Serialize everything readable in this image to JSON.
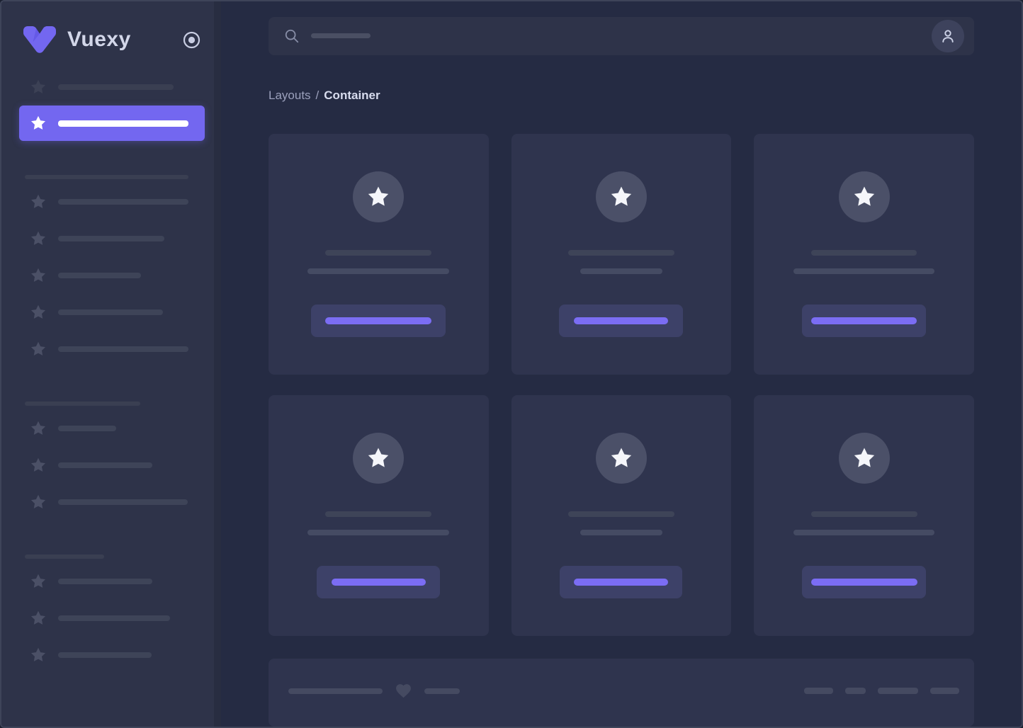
{
  "brand": {
    "name": "Vuexy",
    "logo_color": "#7367f0"
  },
  "breadcrumb": {
    "section": "Layouts",
    "separator": "/",
    "page": "Container"
  },
  "icons": {
    "sidebar_toggle": "radio-dot-icon",
    "nav_item": "star-icon",
    "search": "magnifier-icon",
    "avatar": "person-icon",
    "card_badge": "star-icon",
    "footer": "heart-icon"
  },
  "colors": {
    "accent": "#7367f0",
    "page_bg": "#252b43",
    "sidebar_bg": "#2e3349",
    "card_bg": "#2f344e",
    "skeleton_bar": "#3e4458",
    "button_placeholder_bg": "#3d4168",
    "button_placeholder_bar": "#7b6df4",
    "window_border": "#3e4459"
  },
  "sidebar": {
    "nav": {
      "top_items": 2,
      "active_index": 1,
      "sections": [
        {
          "items": 5
        },
        {
          "items": 3
        },
        {
          "items": 3
        }
      ]
    }
  },
  "main": {
    "search": {
      "state": "empty-placeholder"
    },
    "cards": {
      "count": 6,
      "rows": 2,
      "columns": 3,
      "badge_icon": "star"
    },
    "footer": {
      "left_bars": 2,
      "right_bars": 4
    }
  }
}
